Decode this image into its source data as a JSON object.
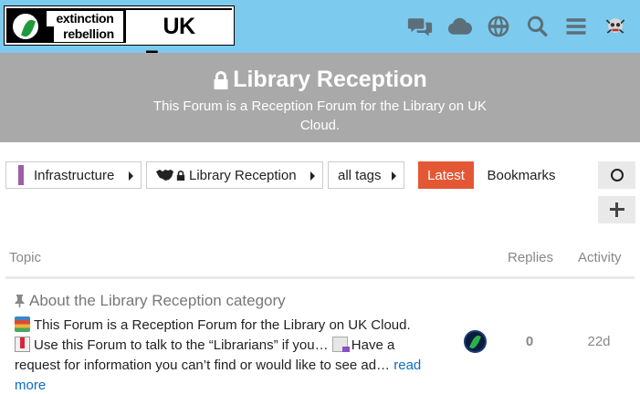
{
  "header": {
    "logo": {
      "line1": "extinction",
      "line2": "rebellion",
      "forum_name": "UK Forum"
    },
    "icons": [
      "chat-icon",
      "cloud-icon",
      "globe-icon",
      "search-icon",
      "hamburger-menu-icon",
      "user-avatar"
    ]
  },
  "banner": {
    "title": "Library Reception",
    "description": "This Forum is a Reception Forum for the Library on UK Cloud."
  },
  "nav": {
    "category": "Infrastructure",
    "subcategory": "Library Reception",
    "tags": "all tags",
    "latest": "Latest",
    "bookmarks": "Bookmarks"
  },
  "table": {
    "col_topic": "Topic",
    "col_replies": "Replies",
    "col_activity": "Activity",
    "rows": [
      {
        "title": "About the Library Reception category",
        "excerpt_1": "This Forum is a Reception Forum for the Library on UK Cloud.",
        "excerpt_2": "Use this Forum to talk to the “Librarians” if you…",
        "excerpt_3": "Have a request for information you can’t find or would like to see ad…",
        "read_more": "read more",
        "replies": "0",
        "activity": "22d"
      }
    ]
  },
  "colors": {
    "header_bg": "#7ccbee",
    "banner_bg": "#a9a9a9",
    "latest_bg": "#e45735",
    "category_color": "#9e5ea5",
    "link_color": "#0a6cbf"
  }
}
